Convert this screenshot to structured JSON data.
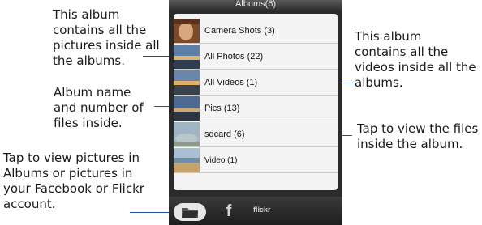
{
  "screen": {
    "title": "Albums(6)"
  },
  "albums": [
    {
      "name": "Camera Shots",
      "count": "(3)",
      "label": "Camera Shots (3)",
      "thumb": "portrait-photo"
    },
    {
      "name": "All Photos",
      "count": "(22)",
      "label": "All Photos (22)",
      "thumb": "sunset-photo"
    },
    {
      "name": "All Videos",
      "count": "(1)",
      "label": "All Videos (1)",
      "thumb": "sunset-video"
    },
    {
      "name": "Pics",
      "count": "(13)",
      "label": "Pics (13)",
      "thumb": "dusk-photo"
    },
    {
      "name": "sdcard",
      "count": "(6)",
      "label": "sdcard (6)",
      "thumb": "sky-photo"
    },
    {
      "name": "Video",
      "count": "(1)",
      "label": "Video (1)",
      "thumb": "coast-video"
    }
  ],
  "bottom_tabs": {
    "albums_icon": "folder-icon",
    "facebook_label": "f",
    "flickr_label": "flickr"
  },
  "callouts": {
    "all_photos": "This album contains all the pictures inside all the albums.",
    "album_name": "Album name and number of files inside.",
    "tabs": "Tap to view pictures in Albums or pictures in your Facebook or Flickr account.",
    "all_videos": "This album contains all the videos inside all the albums.",
    "tap_album": "Tap to view the files inside the album."
  },
  "colors": {
    "leader": "#1f4f9a",
    "list_background": "#f4f4f4",
    "phone_frame": "#2b2b2b"
  }
}
